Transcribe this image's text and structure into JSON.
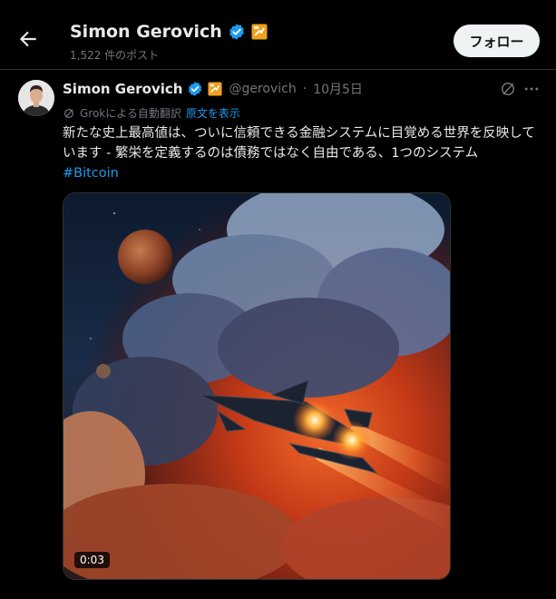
{
  "header": {
    "name": "Simon Gerovich",
    "post_count": "1,522 件のポスト",
    "follow_label": "フォロー"
  },
  "post": {
    "author_name": "Simon Gerovich",
    "handle": "@gerovich",
    "separator": "·",
    "date": "10月5日",
    "translation": {
      "label": "Grokによる自動翻訳",
      "show_original": "原文を表示"
    },
    "text": "新たな史上最高値は、ついに信頼できる金融システムに目覚める世界を反映しています - 繁栄を定義するのは債務ではなく自由である、1つのシステム",
    "hashtag": "#Bitcoin",
    "video_duration": "0:03"
  },
  "colors": {
    "background": "#000000",
    "text": "#e7e9ea",
    "secondary_text": "#71767b",
    "accent_blue": "#1d9bf0",
    "verified_blue": "#1d9bf0",
    "affiliate_badge": "#f0a020",
    "follow_button_bg": "#eff3f4"
  },
  "icons": [
    "back-arrow-icon",
    "verified-badge-icon",
    "affiliate-badge-icon",
    "grok-icon",
    "more-icon",
    "translate-icon"
  ]
}
